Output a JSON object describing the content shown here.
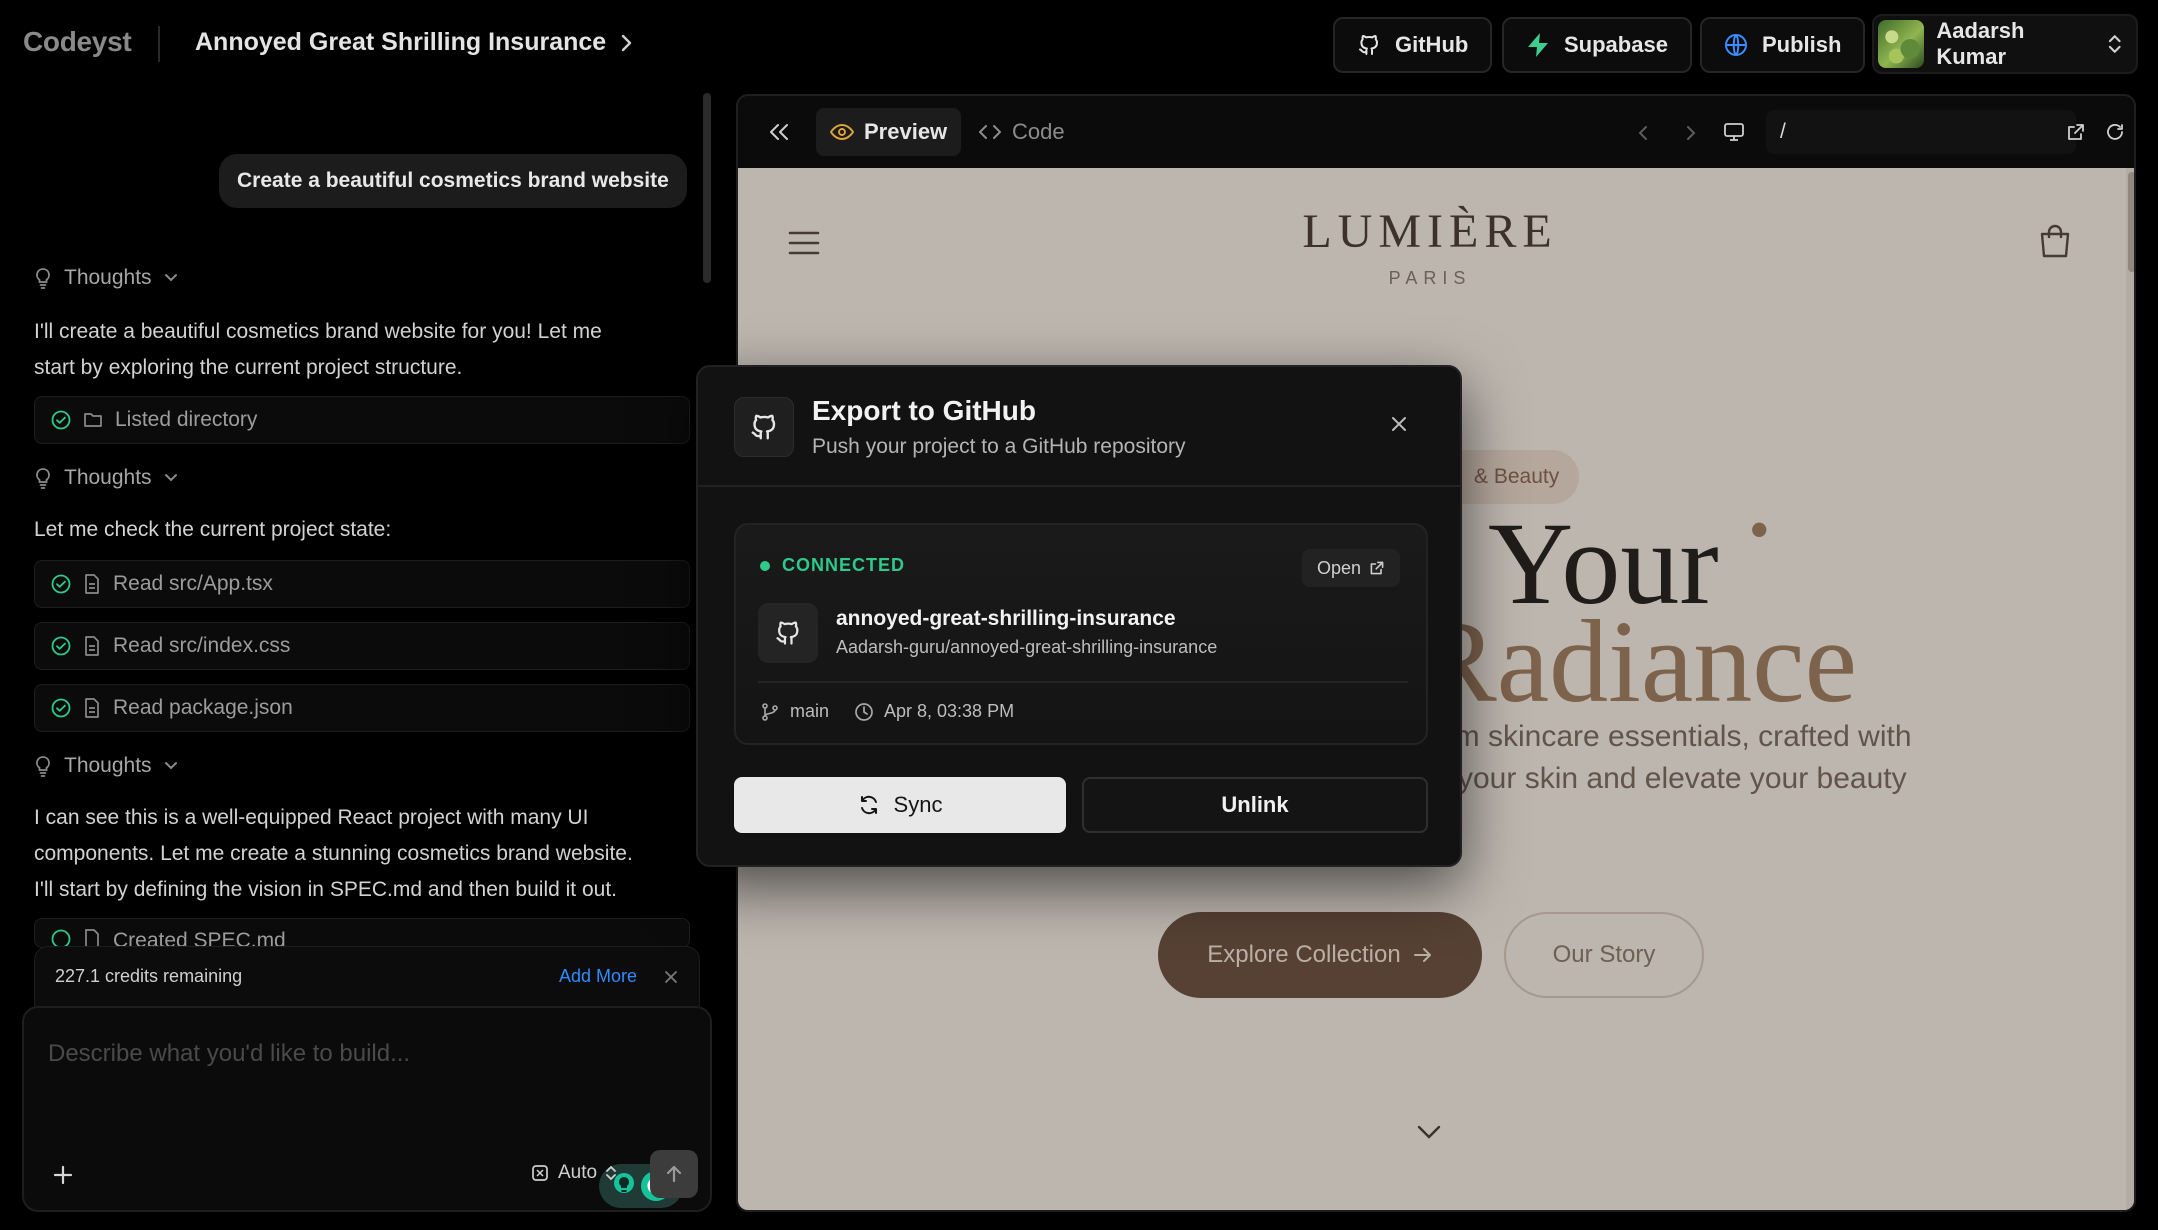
{
  "app": {
    "logo": "Codeyst",
    "project_title": "Annoyed Great Shrilling Insurance"
  },
  "topbar": {
    "github_label": "GitHub",
    "supabase_label": "Supabase",
    "publish_label": "Publish",
    "user_name": "Aadarsh Kumar"
  },
  "chat": {
    "user_message": "Create a beautiful cosmetics brand website",
    "thoughts_label": "Thoughts",
    "msg1_line1": "I'll create a beautiful cosmetics brand website for you! Let me",
    "msg1_line2": "start by exploring the current project structure.",
    "tool_listed": "Listed directory",
    "msg2": "Let me check the current project state:",
    "tool_read_app": "Read src/App.tsx",
    "tool_read_css": "Read src/index.css",
    "tool_read_pkg": "Read package.json",
    "msg3_line1": "I can see this is a well-equipped React project with many UI",
    "msg3_line2": "components. Let me create a stunning cosmetics brand website.",
    "msg3_line3": "I'll start by defining the vision in SPEC.md and then build it out.",
    "tool_created": "Created SPEC.md",
    "credits_text": "227.1 credits remaining",
    "add_more": "Add More",
    "composer_placeholder": "Describe what you'd like to build...",
    "model_label": "Auto"
  },
  "preview": {
    "tab_preview": "Preview",
    "tab_code": "Code",
    "url": "/",
    "brand": "LUMIÈRE",
    "brand_sub": "PARIS",
    "pill_text": "& Beauty",
    "hero_line1": "Your",
    "hero_line2": "Radiance",
    "hero_sub1": "um skincare essentials, crafted with",
    "hero_sub2": "your skin and elevate your beauty",
    "explore_label": "Explore Collection",
    "story_label": "Our Story"
  },
  "modal": {
    "title": "Export to GitHub",
    "subtitle": "Push your project to a GitHub repository",
    "status": "CONNECTED",
    "open_label": "Open",
    "repo_name": "annoyed-great-shrilling-insurance",
    "repo_path": "Aadarsh-guru/annoyed-great-shrilling-insurance",
    "branch": "main",
    "timestamp": "Apr 8, 03:38 PM",
    "sync_label": "Sync",
    "unlink_label": "Unlink"
  },
  "colors": {
    "connected_green": "#2fc98c",
    "link_blue": "#2f8cff",
    "site_bg": "#f1e9df",
    "brand_brown": "#6f5443"
  }
}
